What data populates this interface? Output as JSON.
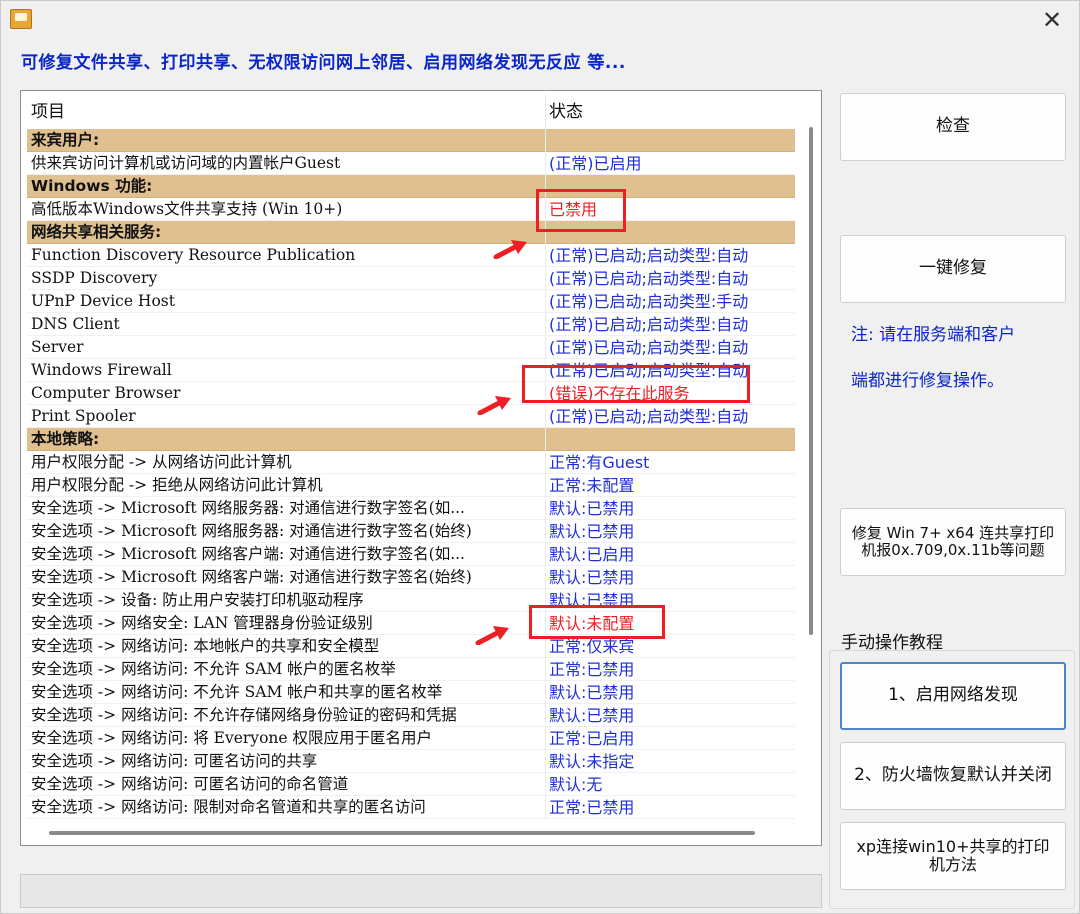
{
  "window": {
    "headline": "可修复文件共享、打印共享、无权限访问网上邻居、启用网络发现无反应  等...",
    "close_glyph": "✕"
  },
  "colors": {
    "normal": "#1f2fd6",
    "error": "#ec1f24",
    "section_bg": "#dfc08e",
    "note": "#0a26c8"
  },
  "table": {
    "headers": {
      "item": "项目",
      "status": "状态"
    },
    "rows": [
      {
        "type": "section",
        "item": "来宾用户:",
        "status": ""
      },
      {
        "type": "row",
        "item": "供来宾访问计算机或访问域的内置帐户Guest",
        "status": "(正常)已启用",
        "tone": "normal"
      },
      {
        "type": "section",
        "item": "Windows 功能:",
        "status": ""
      },
      {
        "type": "row",
        "item": "高低版本Windows文件共享支持 (Win 10+)",
        "status": "已禁用",
        "tone": "error"
      },
      {
        "type": "section",
        "item": "网络共享相关服务:",
        "status": ""
      },
      {
        "type": "row",
        "item": "Function Discovery Resource Publication",
        "status": "(正常)已启动;启动类型:自动",
        "tone": "normal"
      },
      {
        "type": "row",
        "item": "SSDP Discovery",
        "status": "(正常)已启动;启动类型:自动",
        "tone": "normal"
      },
      {
        "type": "row",
        "item": "UPnP Device Host",
        "status": "(正常)已启动;启动类型:手动",
        "tone": "normal"
      },
      {
        "type": "row",
        "item": "DNS Client",
        "status": "(正常)已启动;启动类型:自动",
        "tone": "normal"
      },
      {
        "type": "row",
        "item": "Server",
        "status": "(正常)已启动;启动类型:自动",
        "tone": "normal"
      },
      {
        "type": "row",
        "item": "Windows Firewall",
        "status": "(正常)已启动;启动类型:自动",
        "tone": "normal"
      },
      {
        "type": "row",
        "item": "Computer Browser",
        "status": "(错误)不存在此服务",
        "tone": "error"
      },
      {
        "type": "row",
        "item": "Print Spooler",
        "status": "(正常)已启动;启动类型:自动",
        "tone": "normal"
      },
      {
        "type": "section",
        "item": "本地策略:",
        "status": ""
      },
      {
        "type": "row",
        "item": "用户权限分配 -> 从网络访问此计算机",
        "status": "正常:有Guest",
        "tone": "normal"
      },
      {
        "type": "row",
        "item": "用户权限分配 -> 拒绝从网络访问此计算机",
        "status": "正常:未配置",
        "tone": "normal"
      },
      {
        "type": "row",
        "item": "安全选项 -> Microsoft 网络服务器: 对通信进行数字签名(如...",
        "status": "默认:已禁用",
        "tone": "normal"
      },
      {
        "type": "row",
        "item": "安全选项 -> Microsoft 网络服务器: 对通信进行数字签名(始终)",
        "status": "默认:已禁用",
        "tone": "normal"
      },
      {
        "type": "row",
        "item": "安全选项 -> Microsoft 网络客户端: 对通信进行数字签名(如...",
        "status": "默认:已启用",
        "tone": "normal"
      },
      {
        "type": "row",
        "item": "安全选项 -> Microsoft 网络客户端: 对通信进行数字签名(始终)",
        "status": "默认:已禁用",
        "tone": "normal"
      },
      {
        "type": "row",
        "item": "安全选项 -> 设备: 防止用户安装打印机驱动程序",
        "status": "默认:已禁用",
        "tone": "normal"
      },
      {
        "type": "row",
        "item": "安全选项 -> 网络安全: LAN 管理器身份验证级别",
        "status": "默认:未配置",
        "tone": "error"
      },
      {
        "type": "row",
        "item": "安全选项 -> 网络访问: 本地帐户的共享和安全模型",
        "status": "正常:仅来宾",
        "tone": "normal"
      },
      {
        "type": "row",
        "item": "安全选项 -> 网络访问: 不允许 SAM 帐户的匿名枚举",
        "status": "正常:已禁用",
        "tone": "normal"
      },
      {
        "type": "row",
        "item": "安全选项 -> 网络访问: 不允许 SAM 帐户和共享的匿名枚举",
        "status": "默认:已禁用",
        "tone": "normal"
      },
      {
        "type": "row",
        "item": "安全选项 -> 网络访问: 不允许存储网络身份验证的密码和凭据",
        "status": "默认:已禁用",
        "tone": "normal"
      },
      {
        "type": "row",
        "item": "安全选项 -> 网络访问: 将 Everyone 权限应用于匿名用户",
        "status": "正常:已启用",
        "tone": "normal"
      },
      {
        "type": "row",
        "item": "安全选项 -> 网络访问: 可匿名访问的共享",
        "status": "默认:未指定",
        "tone": "normal"
      },
      {
        "type": "row",
        "item": "安全选项 -> 网络访问: 可匿名访问的命名管道",
        "status": "默认:无",
        "tone": "normal"
      },
      {
        "type": "row",
        "item": "安全选项 -> 网络访问: 限制对命名管道和共享的匿名访问",
        "status": "正常:已禁用",
        "tone": "normal"
      }
    ]
  },
  "sidebar": {
    "check_label": "检查",
    "fix_all_label": "一键修复",
    "note_line1": "注: 请在服务端和客户",
    "note_line2": "端都进行修复操作。",
    "fix_printer_label": "修复 Win 7+ x64 连共享打印机报0x.709,0x.11b等问题",
    "manual_group_label": "手动操作教程",
    "enable_discovery_label": "1、启用网络发现",
    "firewall_label": "2、防火墙恢复默认并关闭",
    "xp_label": "xp连接win10+共享的打印机方法"
  }
}
